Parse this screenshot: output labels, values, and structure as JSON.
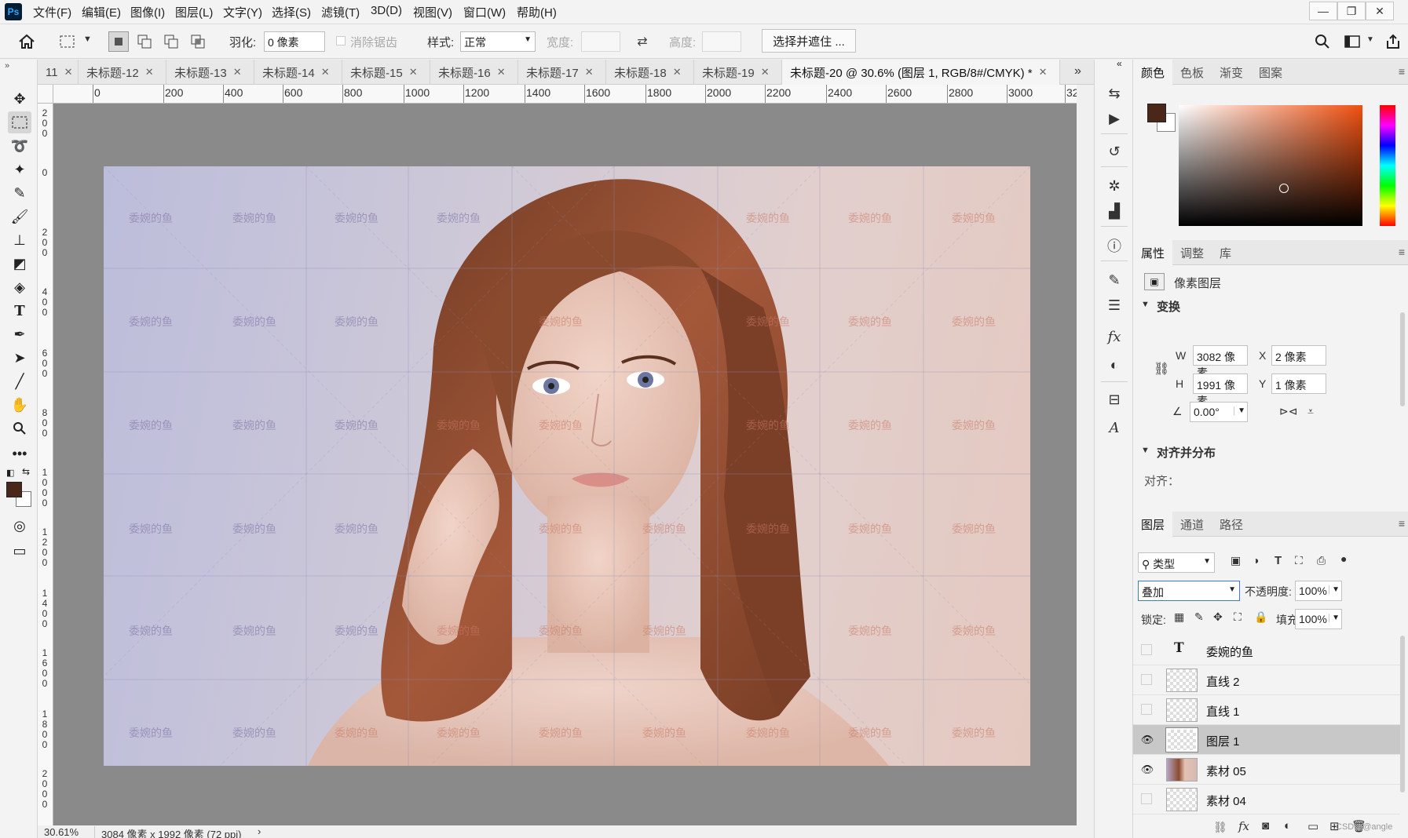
{
  "app": {
    "logo": "Ps"
  },
  "menu": [
    "文件(F)",
    "编辑(E)",
    "图像(I)",
    "图层(L)",
    "文字(Y)",
    "选择(S)",
    "滤镜(T)",
    "3D(D)",
    "视图(V)",
    "窗口(W)",
    "帮助(H)"
  ],
  "window_controls": {
    "minimize": "—",
    "restore": "❐",
    "close": "✕"
  },
  "options": {
    "feather_label": "羽化:",
    "feather_value": "0 像素",
    "antialias_label": "消除锯齿",
    "style_label": "样式:",
    "style_value": "正常",
    "width_label": "宽度:",
    "height_label": "高度:",
    "select_mask_button": "选择并遮住 ..."
  },
  "tabs": [
    {
      "label": "11",
      "active": false
    },
    {
      "label": "未标题-12",
      "active": false
    },
    {
      "label": "未标题-13",
      "active": false
    },
    {
      "label": "未标题-14",
      "active": false
    },
    {
      "label": "未标题-15",
      "active": false
    },
    {
      "label": "未标题-16",
      "active": false
    },
    {
      "label": "未标题-17",
      "active": false
    },
    {
      "label": "未标题-18",
      "active": false
    },
    {
      "label": "未标题-19",
      "active": false
    },
    {
      "label": "未标题-20 @ 30.6% (图层 1, RGB/8#/CMYK) *",
      "active": true
    }
  ],
  "ruler_top": [
    "0",
    "200",
    "400",
    "600",
    "800",
    "1000",
    "1200",
    "1400",
    "1600",
    "1800",
    "2000",
    "2200",
    "2400",
    "2600",
    "2800",
    "3000",
    "32"
  ],
  "ruler_left": [
    "200",
    "0",
    "200",
    "400",
    "600",
    "800",
    "1000",
    "1200",
    "1400",
    "1600",
    "1800",
    "2000"
  ],
  "watermark_text": "委婉的鱼",
  "status": {
    "zoom": "30.61%",
    "doc_size": "3084 像素 x 1992 像素 (72 ppi)"
  },
  "panels": {
    "color_tabs": [
      "颜色",
      "色板",
      "渐变",
      "图案"
    ],
    "foreground_color": "#4a2718",
    "props_tabs": [
      "属性",
      "调整",
      "库"
    ],
    "pixel_layer_label": "像素图层",
    "transform_label": "变换",
    "w_label": "W",
    "w_value": "3082 像素",
    "x_label": "X",
    "x_value": "2 像素",
    "h_label": "H",
    "h_value": "1991 像素",
    "y_label": "Y",
    "y_value": "1 像素",
    "angle_value": "0.00°",
    "align_label": "对齐并分布",
    "align_sub": "对齐：",
    "layers_tabs": [
      "图层",
      "通道",
      "路径"
    ],
    "filter_type": "类型",
    "blend_mode": "叠加",
    "opacity_label": "不透明度:",
    "opacity_value": "100%",
    "lock_label": "锁定:",
    "fill_label": "填充:",
    "fill_value": "100%",
    "layers": [
      {
        "name": "委婉的鱼",
        "kind": "text",
        "visible": false,
        "selected": false
      },
      {
        "name": "直线 2",
        "kind": "shape",
        "visible": false,
        "selected": false
      },
      {
        "name": "直线 1",
        "kind": "shape",
        "visible": false,
        "selected": false
      },
      {
        "name": "图层 1",
        "kind": "pixel",
        "visible": true,
        "selected": true
      },
      {
        "name": "素材 05",
        "kind": "photo",
        "visible": true,
        "selected": false
      },
      {
        "name": "素材 04",
        "kind": "pixel",
        "visible": false,
        "selected": false
      }
    ],
    "credit": "CSDN @angle"
  }
}
